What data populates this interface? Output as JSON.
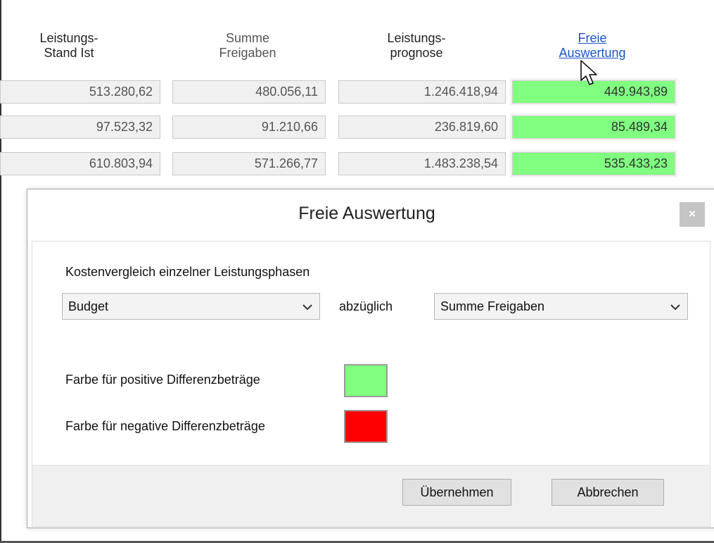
{
  "table": {
    "headers": [
      {
        "line1": "Leistungs-",
        "line2": "Stand Ist"
      },
      {
        "line1": "Summe",
        "line2": "Freigaben"
      },
      {
        "line1": "Leistungs-",
        "line2": "prognose"
      },
      {
        "line1": "Freie",
        "line2": "Auswertung"
      }
    ],
    "rows": [
      [
        "513.280,62",
        "480.056,11",
        "1.246.418,94",
        "449.943,89"
      ],
      [
        "97.523,32",
        "91.210,66",
        "236.819,60",
        "85.489,34"
      ],
      [
        "610.803,94",
        "571.266,77",
        "1.483.238,54",
        "535.433,23"
      ]
    ]
  },
  "dialog": {
    "title": "Freie Auswertung",
    "close_label": "×",
    "section_label": "Kostenvergleich einzelner Leistungsphasen",
    "select_left": "Budget",
    "connector": "abzüglich",
    "select_right": "Summe Freigaben",
    "positive_label": "Farbe für positive Differenzbeträge",
    "negative_label": "Farbe für negative Differenzbeträge",
    "ok_button": "Übernehmen",
    "cancel_button": "Abbrechen"
  },
  "colors": {
    "positive": "#80ff80",
    "negative": "#ff0000",
    "link": "#1a56c8"
  }
}
